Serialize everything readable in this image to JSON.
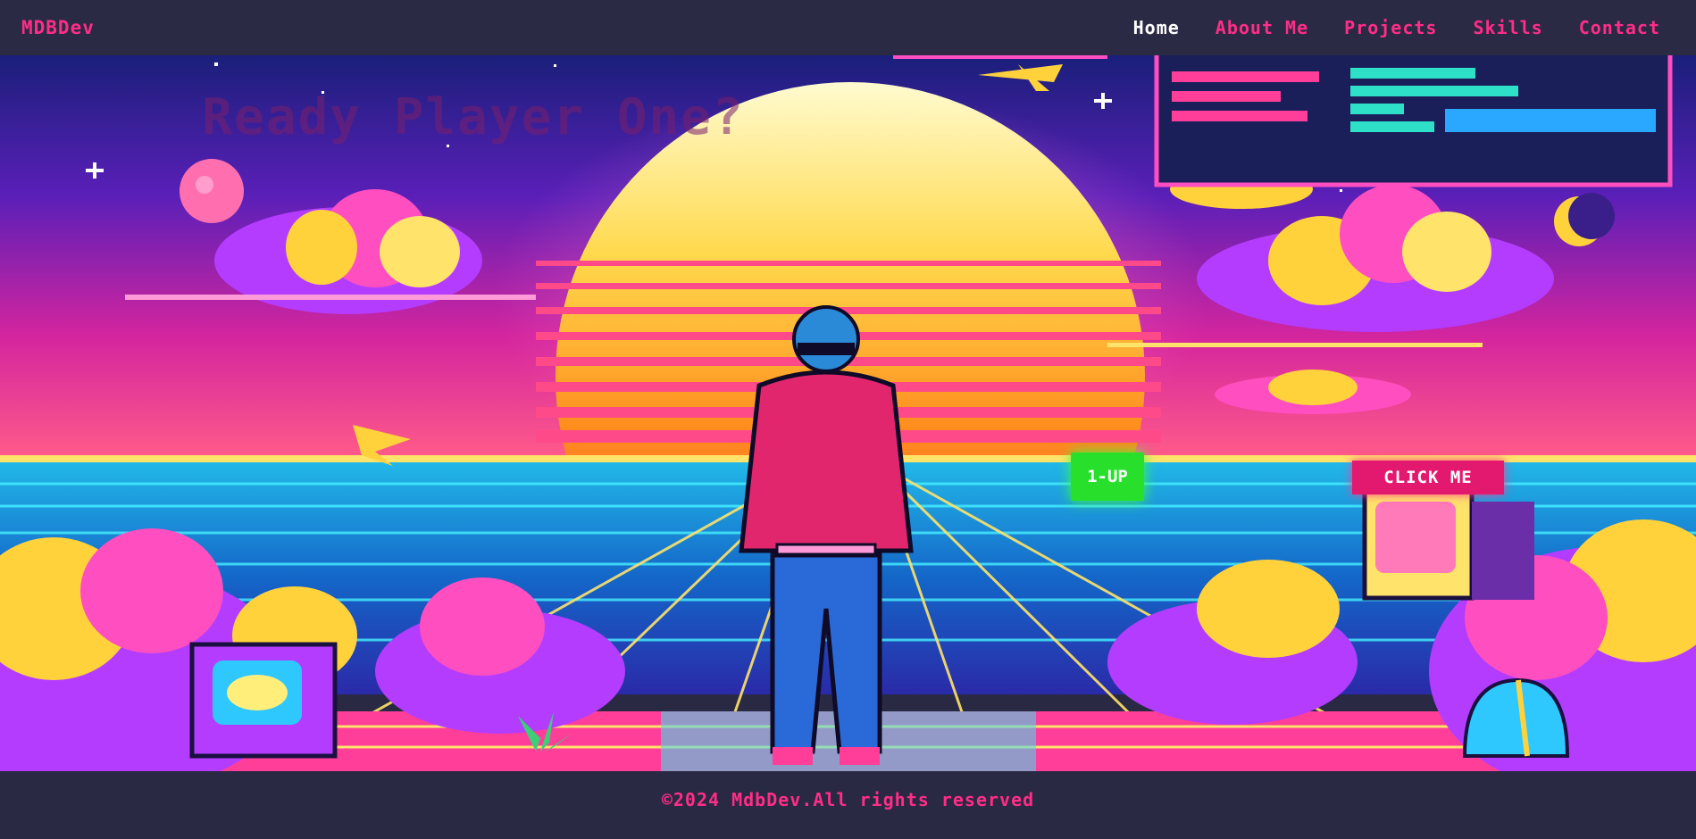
{
  "header": {
    "logo": "MDBDev",
    "nav": [
      {
        "label": "Home",
        "active": true
      },
      {
        "label": "About Me",
        "active": false
      },
      {
        "label": "Projects",
        "active": false
      },
      {
        "label": "Skills",
        "active": false
      },
      {
        "label": "Contact",
        "active": false
      }
    ]
  },
  "hero": {
    "title": "Ready Player One?",
    "oneup_label": "1-UP",
    "click_me_label": "CLICK ME"
  },
  "footer": {
    "copyright": "©2024 MdbDev.All rights reserved"
  },
  "colors": {
    "accent": "#ff2d87",
    "header_bg": "#2b2a45",
    "oneup_green": "#28e02c",
    "button_pink": "#e3196f"
  }
}
